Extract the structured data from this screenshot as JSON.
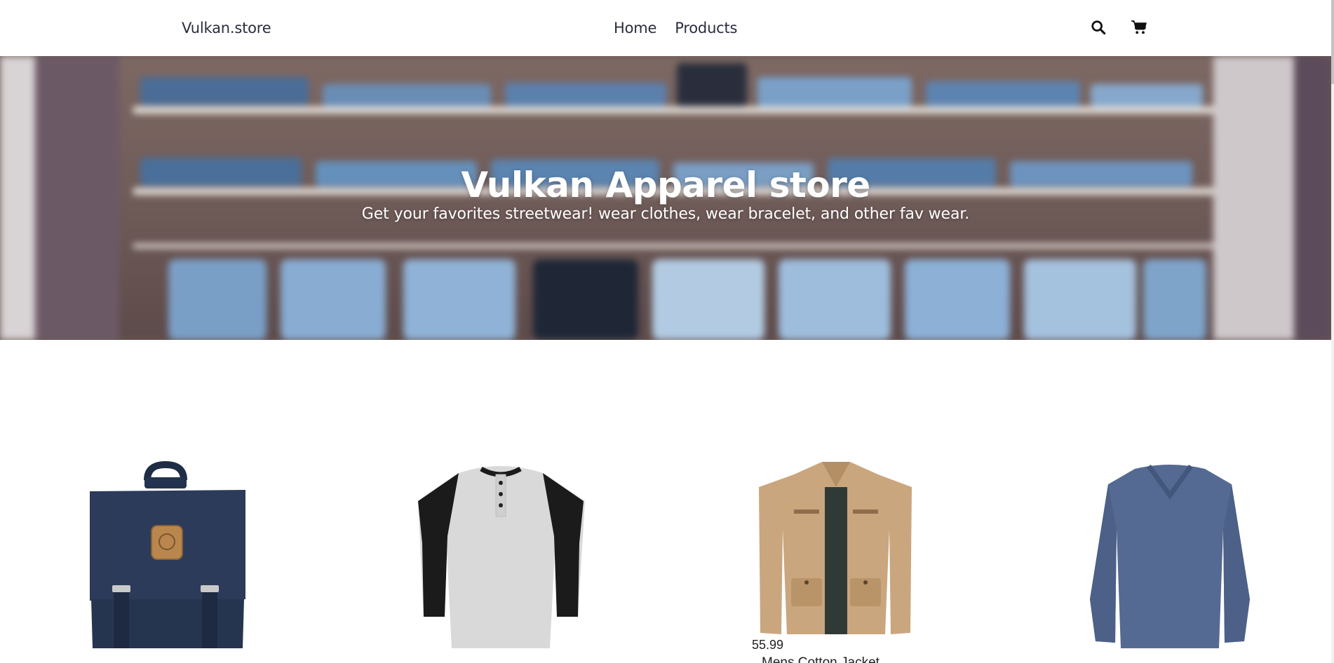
{
  "navbar": {
    "brand": "Vulkan.store",
    "links": [
      "Home",
      "Products"
    ],
    "icons": [
      "search-icon",
      "cart-icon"
    ]
  },
  "hero": {
    "title": "Vulkan Apparel store",
    "subtitle": "Get your favorites streetwear! wear clothes, wear bracelet, and other fav wear."
  },
  "products": [
    {
      "image": "backpack",
      "color": "#2d3d58",
      "price": "",
      "name": ""
    },
    {
      "image": "raglan-henley-shirt",
      "color": "#d7d7d7",
      "price": "",
      "name": ""
    },
    {
      "image": "cotton-jacket",
      "color": "#cfb08a",
      "price": "55.99",
      "name": "Mens Cotton Jacket"
    },
    {
      "image": "long-sleeve-v-neck-shirt",
      "color": "#52658c",
      "price": "",
      "name": ""
    }
  ]
}
